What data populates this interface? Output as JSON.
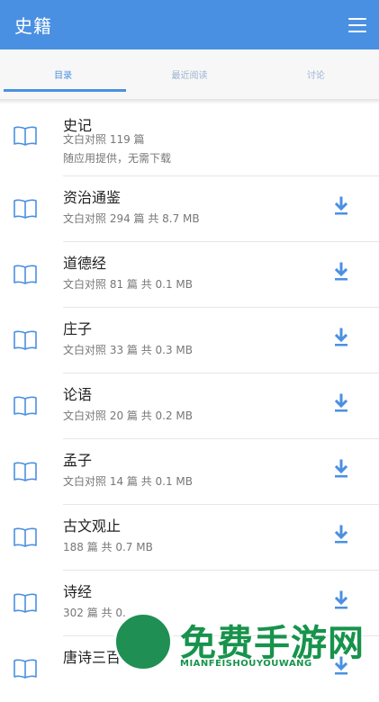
{
  "appbar": {
    "title": "史籍",
    "menu_icon": "menu-icon"
  },
  "tabs": [
    {
      "label": "目录",
      "active": true
    },
    {
      "label": "最近阅读",
      "active": false
    },
    {
      "label": "讨论",
      "active": false
    }
  ],
  "colors": {
    "primary": "#4a90e2",
    "watermark": "#17934c"
  },
  "books": [
    {
      "title": "史记",
      "info": "文白对照 119 篇",
      "note": "随应用提供，无需下载"
    },
    {
      "title": "资治通鉴",
      "info": "文白对照 294 篇 共 8.7 MB",
      "download_icon": "download-icon"
    },
    {
      "title": "道德经",
      "info": "文白对照 81 篇 共 0.1 MB",
      "download_icon": "download-icon"
    },
    {
      "title": "庄子",
      "info": "文白对照 33 篇 共 0.3 MB",
      "download_icon": "download-icon"
    },
    {
      "title": "论语",
      "info": "文白对照 20 篇 共 0.2 MB",
      "download_icon": "download-icon"
    },
    {
      "title": "孟子",
      "info": "文白对照 14 篇 共 0.1 MB",
      "download_icon": "download-icon"
    },
    {
      "title": "古文观止",
      "info": "188 篇 共 0.7 MB",
      "download_icon": "download-icon"
    },
    {
      "title": "诗经",
      "info": "302 篇 共 0.",
      "download_icon": "download-icon"
    },
    {
      "title": "唐诗三百",
      "info": "",
      "download_icon": "download-icon"
    }
  ],
  "watermark": {
    "text": "免费手游网",
    "subtext": "MIANFEISHOUYOUWANG"
  }
}
